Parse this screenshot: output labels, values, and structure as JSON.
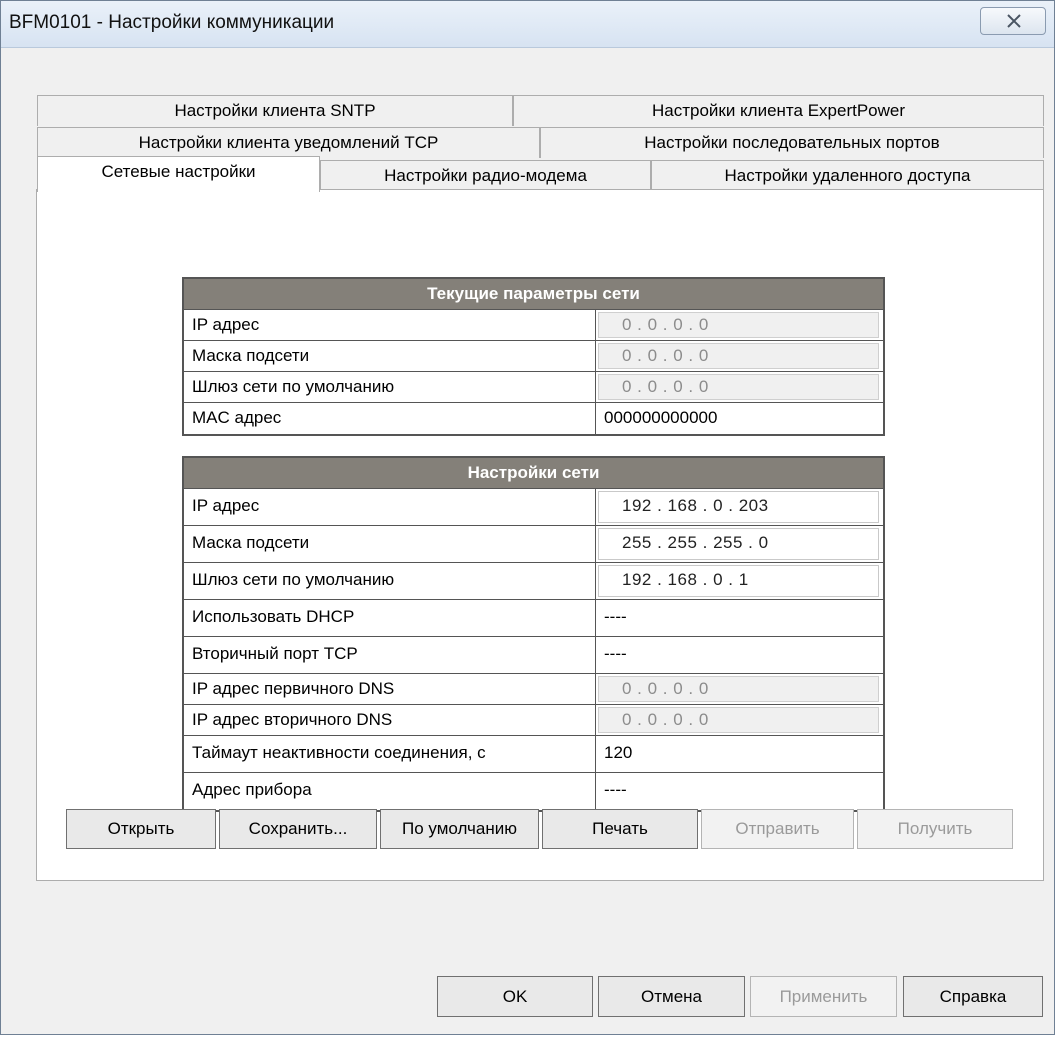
{
  "window": {
    "title": "BFM0101 - Настройки коммуникации",
    "close_symbol": "✕"
  },
  "tabs": {
    "row1": [
      "Настройки клиента SNTP",
      "Настройки клиента ExpertPower"
    ],
    "row2": [
      "Настройки клиента уведомлений TCP",
      "Настройки последовательных портов"
    ],
    "row3": [
      "Сетевые настройки",
      "Настройки радио-модема",
      "Настройки удаленного доступа"
    ],
    "active": "Сетевые настройки"
  },
  "current_params": {
    "header": "Текущие параметры сети",
    "rows": [
      {
        "label": "IP адрес",
        "value": "0  .  0  .  0  .  0"
      },
      {
        "label": "Маска подсети",
        "value": "0  .  0  .  0  .  0"
      },
      {
        "label": "Шлюз сети по умолчанию",
        "value": "0  .  0  .  0  .  0"
      },
      {
        "label": "MAC адрес",
        "value": "000000000000"
      }
    ]
  },
  "network_settings": {
    "header": "Настройки сети",
    "rows": [
      {
        "label": "IP адрес",
        "value": "192 . 168 .  0   . 203"
      },
      {
        "label": "Маска подсети",
        "value": "255 . 255 . 255 .  0"
      },
      {
        "label": "Шлюз сети по умолчанию",
        "value": "192 . 168 .  0   .  1"
      },
      {
        "label": "Использовать DHCP",
        "value": "----"
      },
      {
        "label": "Вторичный порт TCP",
        "value": "----"
      },
      {
        "label": "IP адрес первичного DNS",
        "value": "0  .  0  .  0  .  0"
      },
      {
        "label": "IP адрес вторичного DNS",
        "value": "0  .  0  .  0  .  0"
      },
      {
        "label": "Таймаут неактивности соединения, с",
        "value": "120"
      },
      {
        "label": "Адрес прибора",
        "value": "----"
      }
    ]
  },
  "panel_buttons": {
    "open": "Открыть",
    "save": "Сохранить...",
    "defaults": "По умолчанию",
    "print": "Печать",
    "send": "Отправить",
    "receive": "Получить"
  },
  "footer_buttons": {
    "ok": "OK",
    "cancel": "Отмена",
    "apply": "Применить",
    "help": "Справка"
  }
}
